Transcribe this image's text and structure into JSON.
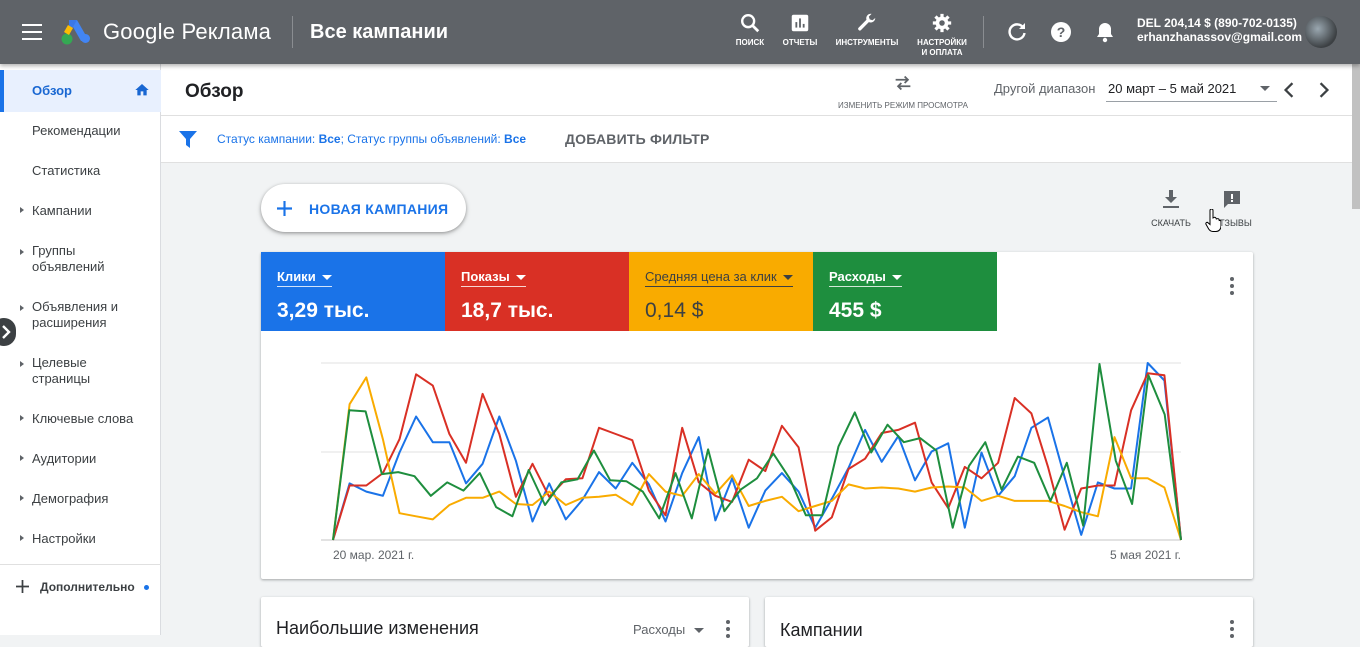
{
  "topbar": {
    "brand": "Google Реклама",
    "page_title": "Все кампании",
    "tools": [
      {
        "icon": "search-icon",
        "label": "ПОИСК"
      },
      {
        "icon": "reports-icon",
        "label": "ОТЧЕТЫ"
      },
      {
        "icon": "wrench-icon",
        "label": "ИНСТРУМЕНТЫ"
      },
      {
        "icon": "gear-icon",
        "label_line1": "НАСТРОЙКИ",
        "label_line2": "И ОПЛАТА"
      }
    ],
    "account_line1": "DEL 204,14 $ (890-702-0135)",
    "account_line2": "erhanzhanassov@gmail.com"
  },
  "sidebar": {
    "items": [
      {
        "label": "Обзор",
        "active": true
      },
      {
        "label": "Рекомендации"
      },
      {
        "label": "Статистика"
      },
      {
        "label": "Кампании"
      },
      {
        "label_line1": "Группы",
        "label_line2": "объявлений"
      },
      {
        "label_line1": "Объявления и",
        "label_line2": "расширения"
      },
      {
        "label_line1": "Целевые",
        "label_line2": "страницы"
      },
      {
        "label": "Ключевые слова"
      },
      {
        "label": "Аудитории"
      },
      {
        "label": "Демография"
      },
      {
        "label": "Настройки"
      }
    ],
    "more_label": "Дополнительно"
  },
  "header": {
    "title": "Обзор",
    "view_mode_label": "ИЗМЕНИТЬ РЕЖИМ ПРОСМОТРА",
    "range_label": "Другой диапазон",
    "date_range": "20 март – 5 май 2021"
  },
  "filter": {
    "part1": "Статус кампании: ",
    "value1": "Все",
    "part2": "; Статус группы объявлений: ",
    "value2": "Все",
    "add_filter": "ДОБАВИТЬ ФИЛЬТР"
  },
  "actions": {
    "new_campaign": "НОВАЯ КАМПАНИЯ",
    "download": "СКАЧАТЬ",
    "feedback": "ОТЗЫВЫ"
  },
  "metrics": [
    {
      "name": "Клики",
      "value": "3,29 тыс.",
      "color": "#1a73e8"
    },
    {
      "name": "Показы",
      "value": "18,7 тыс.",
      "color": "#d93025"
    },
    {
      "name": "Средняя цена за клик",
      "value": "0,14 $",
      "color": "#f9ab00"
    },
    {
      "name": "Расходы",
      "value": "455 $",
      "color": "#1e8e3e"
    }
  ],
  "chart_data": {
    "type": "line",
    "x_start_label": "20 мар. 2021 г.",
    "x_end_label": "5 мая 2021 г.",
    "grid": true,
    "series": [
      {
        "color": "#1a73e8",
        "values": [
          0,
          55,
          47,
          43,
          85,
          120,
          95,
          95,
          55,
          74,
          120,
          77,
          18,
          55,
          20,
          39,
          66,
          50,
          75,
          54,
          18,
          65,
          100,
          19,
          60,
          12,
          48,
          65,
          47,
          12,
          40,
          70,
          107,
          76,
          101,
          58,
          86,
          94,
          12,
          85,
          43,
          62,
          109,
          119,
          61,
          5,
          56,
          50,
          50,
          172,
          155,
          0
        ]
      },
      {
        "color": "#d93025",
        "values": [
          0,
          53,
          53,
          65,
          98,
          161,
          150,
          103,
          75,
          142,
          103,
          42,
          74,
          42,
          59,
          60,
          109,
          103,
          97,
          48,
          24,
          109,
          56,
          43,
          37,
          78,
          67,
          111,
          90,
          9,
          22,
          69,
          79,
          104,
          107,
          114,
          56,
          31,
          71,
          60,
          75,
          138,
          123,
          71,
          10,
          50,
          53,
          53,
          126,
          162,
          160,
          0
        ]
      },
      {
        "color": "#f9ab00",
        "values": [
          0,
          132,
          158,
          98,
          26,
          23,
          20,
          34,
          41,
          41,
          47,
          35,
          34,
          47,
          34,
          41,
          42,
          44,
          34,
          64,
          47,
          43,
          64,
          45,
          63,
          33,
          38,
          42,
          28,
          33,
          38,
          54,
          50,
          51,
          50,
          47,
          51,
          52,
          51,
          38,
          43,
          38,
          38,
          38,
          33,
          27,
          23,
          100,
          60,
          60,
          51,
          0
        ]
      },
      {
        "color": "#1e8e3e",
        "values": [
          0,
          126,
          125,
          64,
          66,
          62,
          43,
          56,
          48,
          65,
          32,
          23,
          68,
          34,
          56,
          59,
          87,
          58,
          57,
          47,
          21,
          65,
          21,
          88,
          28,
          49,
          60,
          84,
          60,
          24,
          24,
          91,
          124,
          85,
          112,
          95,
          99,
          87,
          12,
          72,
          95,
          49,
          81,
          75,
          38,
          75,
          14,
          171,
          77,
          35,
          160,
          122,
          0
        ]
      }
    ]
  },
  "bottom_cards": {
    "left_title": "Наибольшие изменения",
    "left_metric": "Расходы",
    "right_title": "Кампании"
  }
}
